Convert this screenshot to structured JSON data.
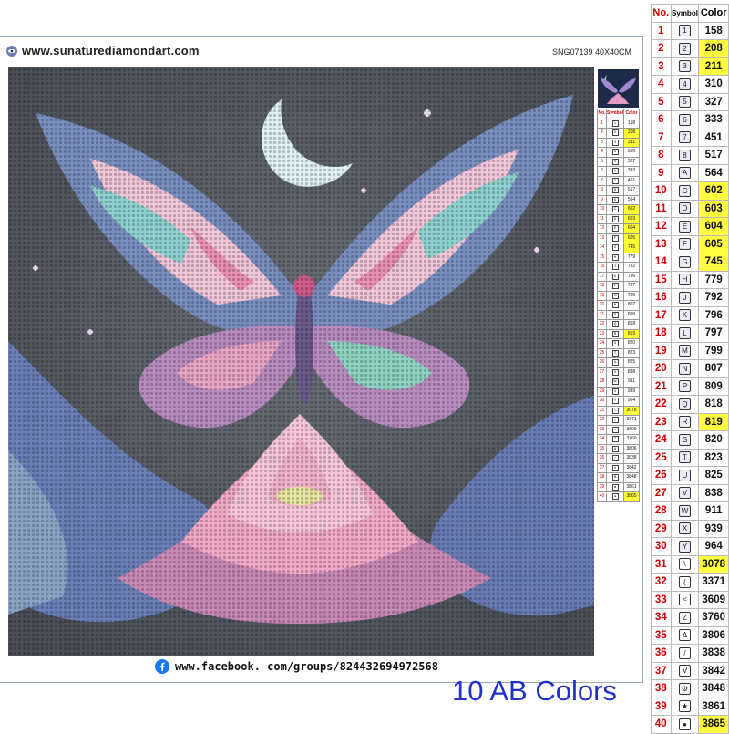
{
  "header": {
    "url": "www.sunaturediamondart.com",
    "product_code": "SNG07139 40X40CM"
  },
  "footer": {
    "facebook_url": "www.facebook. com/groups/824432694972568"
  },
  "note": {
    "ab_colors": "10 AB Colors"
  },
  "colors": {
    "frame_border": "#9aa9b8",
    "highlight": "#ffff40",
    "row_number": "#d00000",
    "ab_text": "#2030c8",
    "facebook_blue": "#1877f2"
  },
  "color_table": {
    "headers": [
      "No.",
      "Symbol",
      "Color"
    ],
    "rows": [
      {
        "no": "1",
        "symbol": "1",
        "color": "158",
        "highlight": false
      },
      {
        "no": "2",
        "symbol": "2",
        "color": "208",
        "highlight": true
      },
      {
        "no": "3",
        "symbol": "3",
        "color": "211",
        "highlight": true
      },
      {
        "no": "4",
        "symbol": "4",
        "color": "310",
        "highlight": false
      },
      {
        "no": "5",
        "symbol": "5",
        "color": "327",
        "highlight": false
      },
      {
        "no": "6",
        "symbol": "6",
        "color": "333",
        "highlight": false
      },
      {
        "no": "7",
        "symbol": "7",
        "color": "451",
        "highlight": false
      },
      {
        "no": "8",
        "symbol": "8",
        "color": "517",
        "highlight": false
      },
      {
        "no": "9",
        "symbol": "A",
        "color": "564",
        "highlight": false
      },
      {
        "no": "10",
        "symbol": "C",
        "color": "602",
        "highlight": true
      },
      {
        "no": "11",
        "symbol": "D",
        "color": "603",
        "highlight": true
      },
      {
        "no": "12",
        "symbol": "E",
        "color": "604",
        "highlight": true
      },
      {
        "no": "13",
        "symbol": "F",
        "color": "605",
        "highlight": true
      },
      {
        "no": "14",
        "symbol": "G",
        "color": "745",
        "highlight": true
      },
      {
        "no": "15",
        "symbol": "H",
        "color": "779",
        "highlight": false
      },
      {
        "no": "16",
        "symbol": "J",
        "color": "792",
        "highlight": false
      },
      {
        "no": "17",
        "symbol": "K",
        "color": "796",
        "highlight": false
      },
      {
        "no": "18",
        "symbol": "L",
        "color": "797",
        "highlight": false
      },
      {
        "no": "19",
        "symbol": "M",
        "color": "799",
        "highlight": false
      },
      {
        "no": "20",
        "symbol": "N",
        "color": "807",
        "highlight": false
      },
      {
        "no": "21",
        "symbol": "P",
        "color": "809",
        "highlight": false
      },
      {
        "no": "22",
        "symbol": "Q",
        "color": "818",
        "highlight": false
      },
      {
        "no": "23",
        "symbol": "R",
        "color": "819",
        "highlight": true
      },
      {
        "no": "24",
        "symbol": "S",
        "color": "820",
        "highlight": false
      },
      {
        "no": "25",
        "symbol": "T",
        "color": "823",
        "highlight": false
      },
      {
        "no": "26",
        "symbol": "U",
        "color": "825",
        "highlight": false
      },
      {
        "no": "27",
        "symbol": "V",
        "color": "838",
        "highlight": false
      },
      {
        "no": "28",
        "symbol": "W",
        "color": "911",
        "highlight": false
      },
      {
        "no": "29",
        "symbol": "X",
        "color": "939",
        "highlight": false
      },
      {
        "no": "30",
        "symbol": "Y",
        "color": "964",
        "highlight": false
      },
      {
        "no": "31",
        "symbol": "\\",
        "color": "3078",
        "highlight": true
      },
      {
        "no": "32",
        "symbol": "(",
        "color": "3371",
        "highlight": false
      },
      {
        "no": "33",
        "symbol": "<",
        "color": "3609",
        "highlight": false
      },
      {
        "no": "34",
        "symbol": "Z",
        "color": "3760",
        "highlight": false
      },
      {
        "no": "35",
        "symbol": "Δ",
        "color": "3806",
        "highlight": false
      },
      {
        "no": "36",
        "symbol": "/",
        "color": "3838",
        "highlight": false
      },
      {
        "no": "37",
        "symbol": "V",
        "color": "3842",
        "highlight": false
      },
      {
        "no": "38",
        "symbol": "⚙",
        "color": "3848",
        "highlight": false
      },
      {
        "no": "39",
        "symbol": "★",
        "color": "3861",
        "highlight": false
      },
      {
        "no": "40",
        "symbol": "●",
        "color": "3865",
        "highlight": true
      }
    ]
  }
}
